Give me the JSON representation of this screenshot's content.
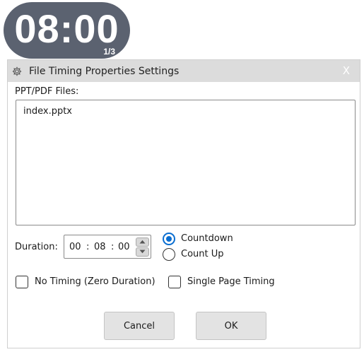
{
  "timer": {
    "time": "08:00",
    "page": "1/3"
  },
  "dialog": {
    "title": "File Timing Properties Settings",
    "close_label": "X",
    "files_label": "PPT/PDF Files:",
    "files": [
      "index.pptx"
    ],
    "duration": {
      "label": "Duration:",
      "hours": "00",
      "minutes": "08",
      "seconds": "00",
      "separator": ":"
    },
    "mode_options": [
      {
        "label": "Countdown",
        "selected": true
      },
      {
        "label": "Count Up",
        "selected": false
      }
    ],
    "options": [
      {
        "label": "No Timing (Zero Duration)",
        "checked": false
      },
      {
        "label": "Single Page Timing",
        "checked": false
      }
    ],
    "buttons": {
      "cancel": "Cancel",
      "ok": "OK"
    }
  },
  "colors": {
    "timer_bg": "#5b6270",
    "titlebar_bg": "#dcdcdc",
    "accent": "#0a6ed1",
    "button_bg": "#e3e3e3"
  },
  "icons": {
    "settings": "gear-icon",
    "close": "close-icon"
  }
}
